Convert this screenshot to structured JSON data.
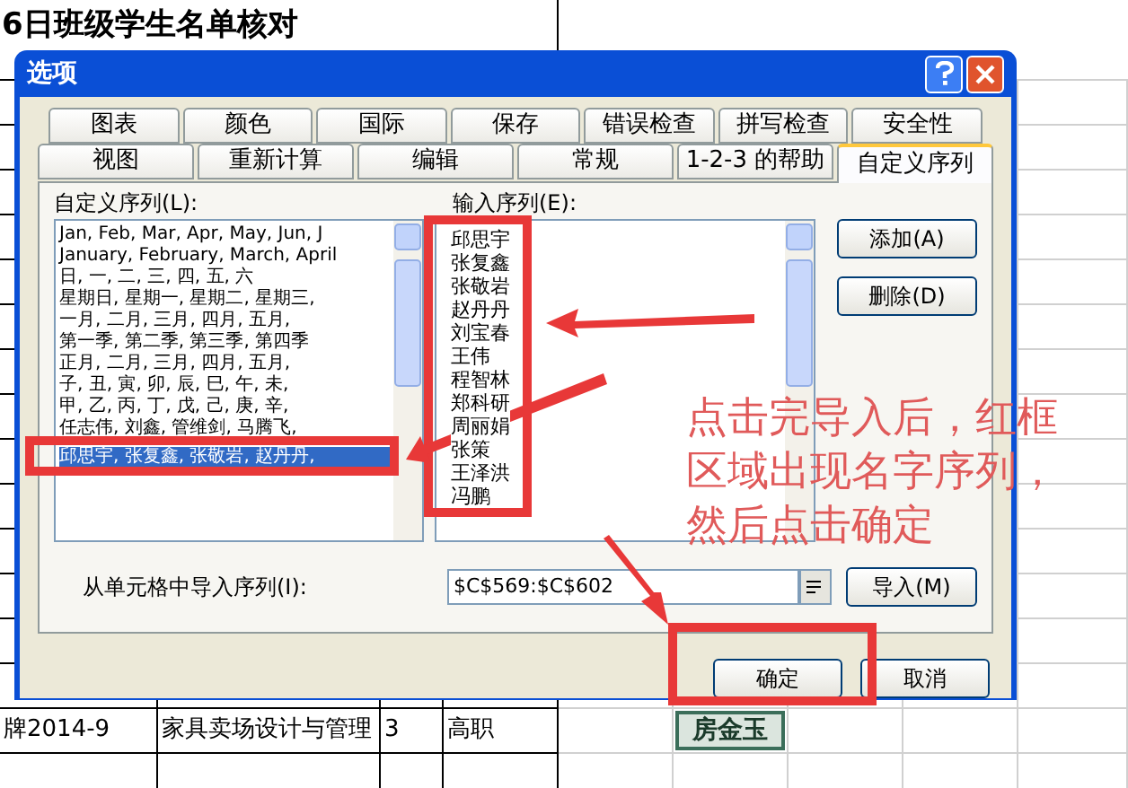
{
  "sheet": {
    "title": "6日班级学生名单核对",
    "rows": [
      {
        "cells": [
          "牌2014-9",
          "家具卖场设计与管理",
          "3",
          "高职"
        ],
        "name_tag": "房金玉"
      }
    ]
  },
  "dialog": {
    "title": "选项",
    "tabs_row1": [
      {
        "label": "图表",
        "selected": false
      },
      {
        "label": "颜色",
        "selected": false
      },
      {
        "label": "国际",
        "selected": false
      },
      {
        "label": "保存",
        "selected": false
      },
      {
        "label": "错误检查",
        "selected": false
      },
      {
        "label": "拼写检查",
        "selected": false
      },
      {
        "label": "安全性",
        "selected": false
      }
    ],
    "tabs_row2": [
      {
        "label": "视图",
        "selected": false
      },
      {
        "label": "重新计算",
        "selected": false
      },
      {
        "label": "编辑",
        "selected": false
      },
      {
        "label": "常规",
        "selected": false
      },
      {
        "label": "1-2-3 的帮助",
        "selected": false
      },
      {
        "label": "自定义序列",
        "selected": true
      }
    ],
    "custom_lists": {
      "label": "自定义序列(L):",
      "items": [
        {
          "text": "Jan, Feb, Mar, Apr, May, Jun, J",
          "selected": false
        },
        {
          "text": "January, February, March, April",
          "selected": false
        },
        {
          "text": "日, 一, 二, 三, 四, 五, 六",
          "selected": false
        },
        {
          "text": "星期日, 星期一, 星期二, 星期三,",
          "selected": false
        },
        {
          "text": "一月, 二月, 三月, 四月, 五月,",
          "selected": false
        },
        {
          "text": "第一季, 第二季, 第三季, 第四季",
          "selected": false
        },
        {
          "text": "正月, 二月, 三月, 四月, 五月,",
          "selected": false
        },
        {
          "text": "子, 丑, 寅, 卯, 辰, 巳, 午, 未,",
          "selected": false
        },
        {
          "text": "甲, 乙, 丙, 丁, 戊, 己, 庚, 辛,",
          "selected": false
        },
        {
          "text": "任志伟, 刘鑫, 管维剑, 马腾飞,",
          "selected": false
        },
        {
          "text": "邱思宇, 张复鑫, 张敬岩, 赵丹丹,",
          "selected": true
        }
      ]
    },
    "entries": {
      "label": "输入序列(E):",
      "items": [
        "邱思宇",
        "张复鑫",
        "张敬岩",
        "赵丹丹",
        "刘宝春",
        "王伟",
        "程智林",
        "郑科研",
        "周丽娟",
        "张策",
        "王泽洪",
        "冯鹏"
      ]
    },
    "side_buttons": [
      "添加(A)",
      "删除(D)"
    ],
    "import": {
      "label": "从单元格中导入序列(I):",
      "value": "$C$569:$C$602",
      "button": "导入(M)"
    },
    "buttons": [
      "确定",
      "取消"
    ]
  },
  "annotation": {
    "lines": [
      "点击完导入后，红框",
      "区域出现名字序列，",
      "然后点击确定"
    ]
  }
}
